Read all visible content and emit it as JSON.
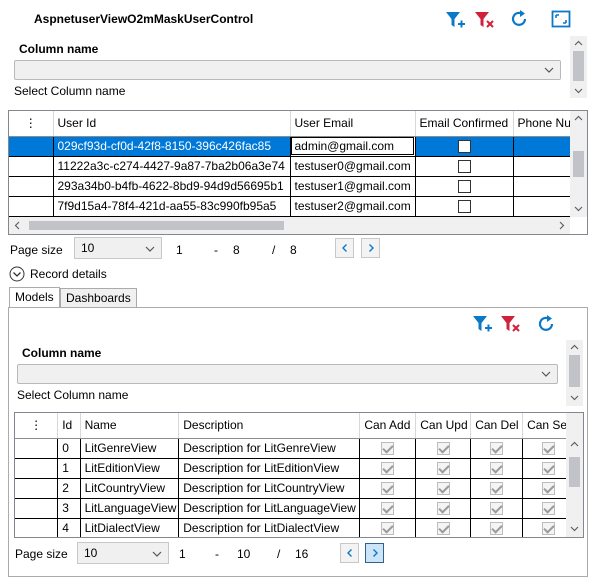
{
  "window": {
    "title": "AspnetuserViewO2mMaskUserControl"
  },
  "toolbar": {
    "icons": [
      "filter-add-icon",
      "filter-clear-icon",
      "refresh-icon",
      "fullscreen-icon"
    ]
  },
  "colors": {
    "accent": "#0078d7",
    "filter_add": "#0c78c8",
    "filter_clear": "#d0213b"
  },
  "top_filter": {
    "label": "Column name",
    "combo_value": "",
    "hint": "Select Column name"
  },
  "user_grid": {
    "columns": [
      "User Id",
      "User Email",
      "Email Confirmed",
      "Phone Nu"
    ],
    "rows": [
      {
        "id": "029cf93d-cf0d-42f8-8150-396c426fac85",
        "email": "admin@gmail.com",
        "confirmed": false
      },
      {
        "id": "11222a3c-c274-4427-9a87-7ba2b06a3e74",
        "email": "testuser0@gmail.com",
        "confirmed": false
      },
      {
        "id": "293a34b0-b4fb-4622-8bd9-94d9d56695b1",
        "email": "testuser1@gmail.com",
        "confirmed": false
      },
      {
        "id": "7f9d15a4-78f4-421d-aa55-83c990fb95a5",
        "email": "testuser2@gmail.com",
        "confirmed": false
      }
    ]
  },
  "top_pager": {
    "label": "Page size",
    "page_size": "10",
    "from": "1",
    "dash": "-",
    "to": "8",
    "slash": "/",
    "total": "8"
  },
  "record_details": {
    "label": "Record details"
  },
  "tabs": [
    "Models",
    "Dashboards"
  ],
  "models_filter": {
    "label": "Column name",
    "combo_value": "",
    "hint": "Select Column name"
  },
  "models_grid": {
    "columns": [
      "Id",
      "Name",
      "Description",
      "Can Add",
      "Can Upd",
      "Can Del",
      "Can Sel"
    ],
    "rows": [
      {
        "id": "0",
        "name": "LitGenreView",
        "desc": "Description for LitGenreView"
      },
      {
        "id": "1",
        "name": "LitEditionView",
        "desc": "Description for LitEditionView"
      },
      {
        "id": "2",
        "name": "LitCountryView",
        "desc": "Description for LitCountryView"
      },
      {
        "id": "3",
        "name": "LitLanguageView",
        "desc": "Description for LitLanguageView"
      },
      {
        "id": "4",
        "name": "LitDialectView",
        "desc": "Description for LitDialectView"
      }
    ]
  },
  "bottom_pager": {
    "label": "Page size",
    "page_size": "10",
    "from": "1",
    "dash": "-",
    "to": "10",
    "slash": "/",
    "total": "16"
  }
}
